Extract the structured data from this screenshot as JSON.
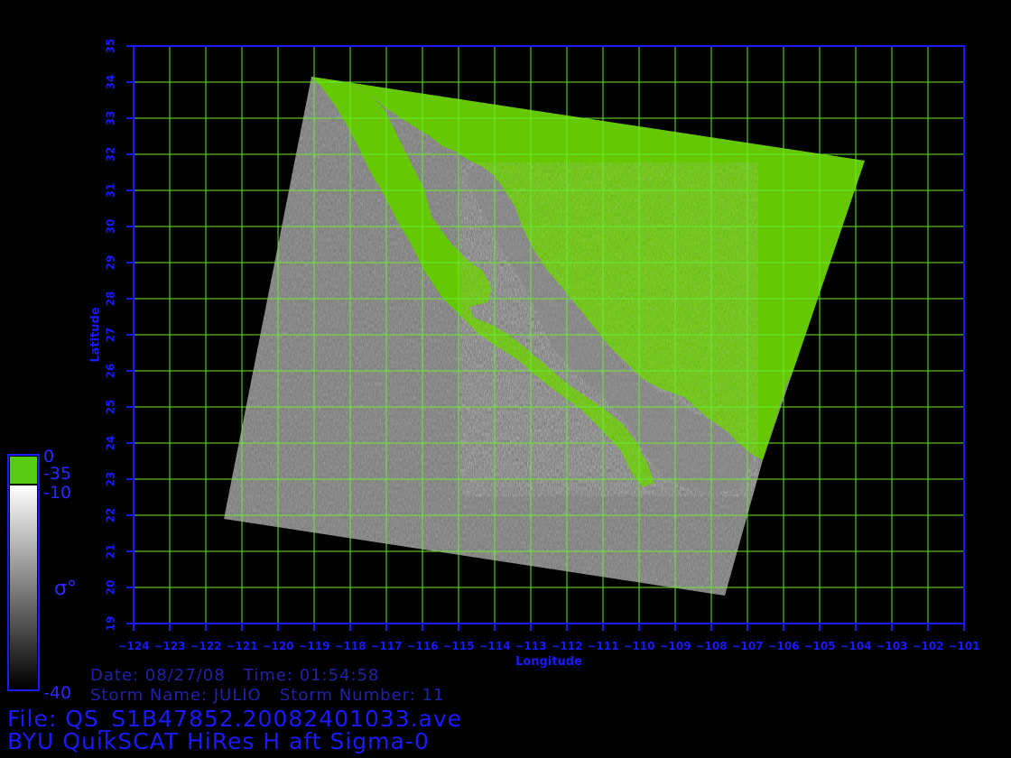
{
  "map": {
    "x_axis": {
      "label": "Longitude",
      "min": -124,
      "max": -101,
      "tick_labels": [
        "-124",
        "-123",
        "-122",
        "-121",
        "-120",
        "-119",
        "-118",
        "-117",
        "-116",
        "-115",
        "-114",
        "-113",
        "-112",
        "-111",
        "-110",
        "-109",
        "-108",
        "-107",
        "-106",
        "-105",
        "-104",
        "-103",
        "-102",
        "-101"
      ]
    },
    "y_axis": {
      "label": "Latitude",
      "min": 19,
      "max": 35,
      "tick_labels": [
        "19",
        "20",
        "21",
        "22",
        "23",
        "24",
        "25",
        "26",
        "27",
        "28",
        "29",
        "30",
        "31",
        "32",
        "33",
        "34",
        "35"
      ]
    },
    "grid": true,
    "colors": {
      "grid": "#66ee33",
      "axis": "#1a1aff",
      "background": "#000000",
      "land_green": "#66cc00",
      "sea_gray": "#777777"
    },
    "swath_corners": [
      {
        "lon": -118.9,
        "lat": 34.1
      },
      {
        "lon": -103.5,
        "lat": 31.8
      },
      {
        "lon": -106.5,
        "lat": 23.5
      },
      {
        "lon": -107.5,
        "lat": 19.8
      },
      {
        "lon": -121.0,
        "lat": 21.9
      }
    ]
  },
  "colorbar": {
    "label": "σ°",
    "ticks": [
      "0",
      "-35",
      "-10",
      "-40"
    ],
    "colors": {
      "top": "#55cc11",
      "gray_top": "#ffffff",
      "gray_bottom": "#000000",
      "border": "#1a1aff"
    }
  },
  "info": {
    "date_line": "Date: 08/27/08   Time: 01:54:58",
    "storm_line": "Storm Name: JULIO   Storm Number: 11",
    "file_line": "File: QS_S1B47852.20082401033.ave",
    "title_line": "BYU QuikSCAT HiRes H aft Sigma-0"
  }
}
